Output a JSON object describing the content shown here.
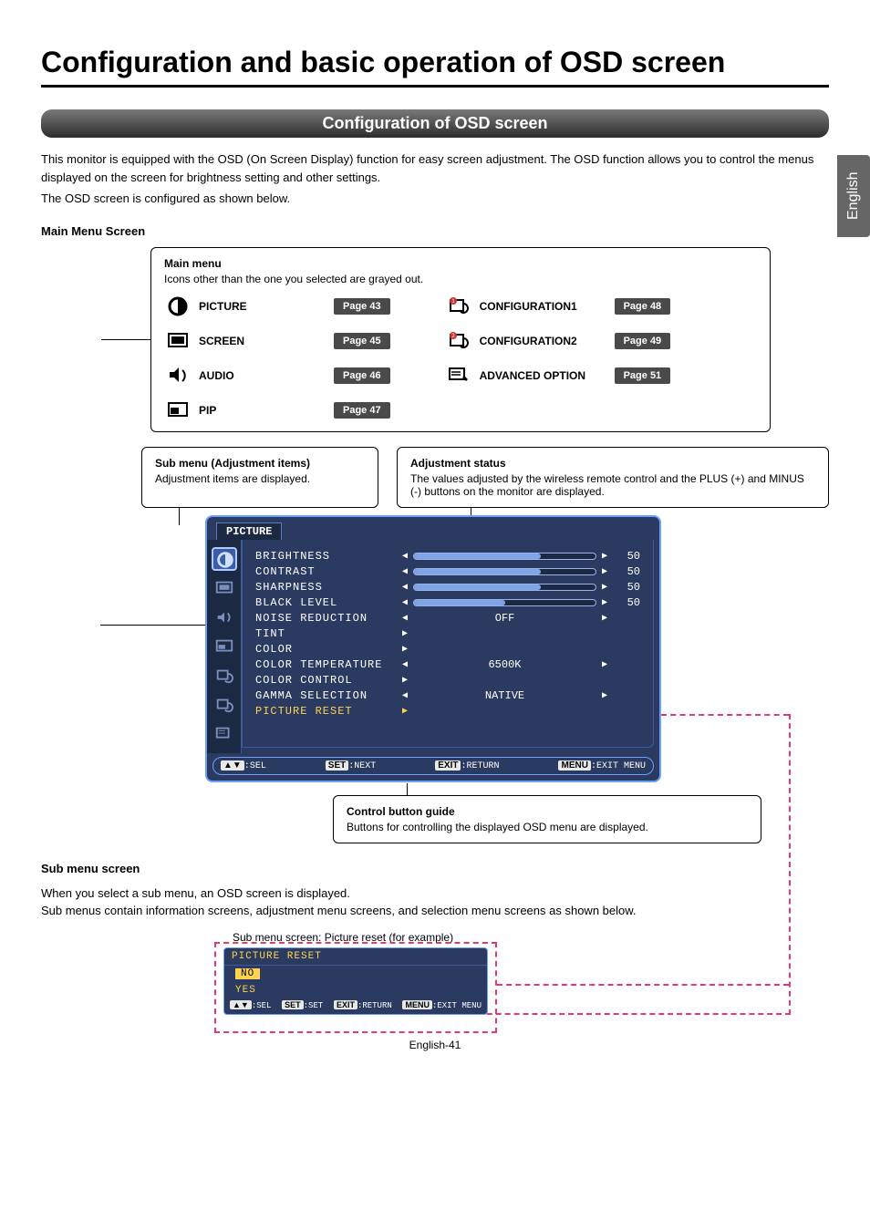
{
  "sideTab": "English",
  "pageTitle": "Configuration and basic operation of OSD screen",
  "sectionBar": "Configuration of OSD screen",
  "intro": {
    "p1": "This monitor is equipped with the OSD (On Screen Display) function for easy screen adjustment. The OSD function allows you to control the menus displayed on the screen for brightness setting and other settings.",
    "p2": "The OSD screen is configured as shown below."
  },
  "mainMenuHeading": "Main Menu Screen",
  "mainMenuCallout": {
    "title": "Main menu",
    "desc": "Icons other than the one you selected are grayed out.",
    "left": [
      {
        "label": "PICTURE",
        "page": "Page 43"
      },
      {
        "label": "SCREEN",
        "page": "Page 45"
      },
      {
        "label": "AUDIO",
        "page": "Page 46"
      },
      {
        "label": "PIP",
        "page": "Page 47"
      }
    ],
    "right": [
      {
        "label": "CONFIGURATION1",
        "page": "Page 48"
      },
      {
        "label": "CONFIGURATION2",
        "page": "Page 49"
      },
      {
        "label": "ADVANCED OPTION",
        "page": "Page 51"
      }
    ]
  },
  "subMenuCallout": {
    "title": "Sub menu (Adjustment items)",
    "desc": "Adjustment items are displayed."
  },
  "adjStatusCallout": {
    "title": "Adjustment status",
    "desc": "The values adjusted by the wireless remote control and the PLUS (+) and MINUS (-) buttons on the monitor are displayed."
  },
  "osd": {
    "tab": "PICTURE",
    "rows": [
      {
        "label": "BRIGHTNESS",
        "type": "slider",
        "fill": 70,
        "value": "50"
      },
      {
        "label": "CONTRAST",
        "type": "slider",
        "fill": 70,
        "value": "50"
      },
      {
        "label": "SHARPNESS",
        "type": "slider",
        "fill": 70,
        "value": "50"
      },
      {
        "label": "BLACK LEVEL",
        "type": "slider",
        "fill": 50,
        "value": "50"
      },
      {
        "label": "NOISE REDUCTION",
        "type": "select",
        "value": "OFF"
      },
      {
        "label": "TINT",
        "type": "nav"
      },
      {
        "label": "COLOR",
        "type": "nav"
      },
      {
        "label": "COLOR TEMPERATURE",
        "type": "select",
        "value": "6500K"
      },
      {
        "label": "COLOR CONTROL",
        "type": "nav"
      },
      {
        "label": "GAMMA SELECTION",
        "type": "select",
        "value": "NATIVE"
      },
      {
        "label": "PICTURE RESET",
        "type": "enter",
        "highlight": true
      }
    ],
    "footer": {
      "sel": "SEL",
      "selKey": "▲▼",
      "next": "NEXT",
      "nextKey": "SET",
      "return": "RETURN",
      "returnKey": "EXIT",
      "exit": "EXIT MENU",
      "exitKey": "MENU"
    }
  },
  "ctrlCallout": {
    "title": "Control button guide",
    "desc": "Buttons for controlling the displayed OSD menu are displayed."
  },
  "subMenuScreen": {
    "heading": "Sub menu screen",
    "p1": "When you select a sub menu, an OSD screen is displayed.",
    "p2": "Sub menus contain information screens, adjustment menu screens, and selection menu screens as shown below.",
    "caption": "Sub menu screen: Picture reset (for example)"
  },
  "subOsd": {
    "header": "PICTURE RESET",
    "opt1": "NO",
    "opt2": "YES",
    "footer": {
      "sel": "SEL",
      "selKey": "▲▼",
      "set": "SET",
      "setKey": "SET",
      "return": "RETURN",
      "returnKey": "EXIT",
      "exit": "EXIT MENU",
      "exitKey": "MENU"
    }
  },
  "pageFooter": "English-41"
}
